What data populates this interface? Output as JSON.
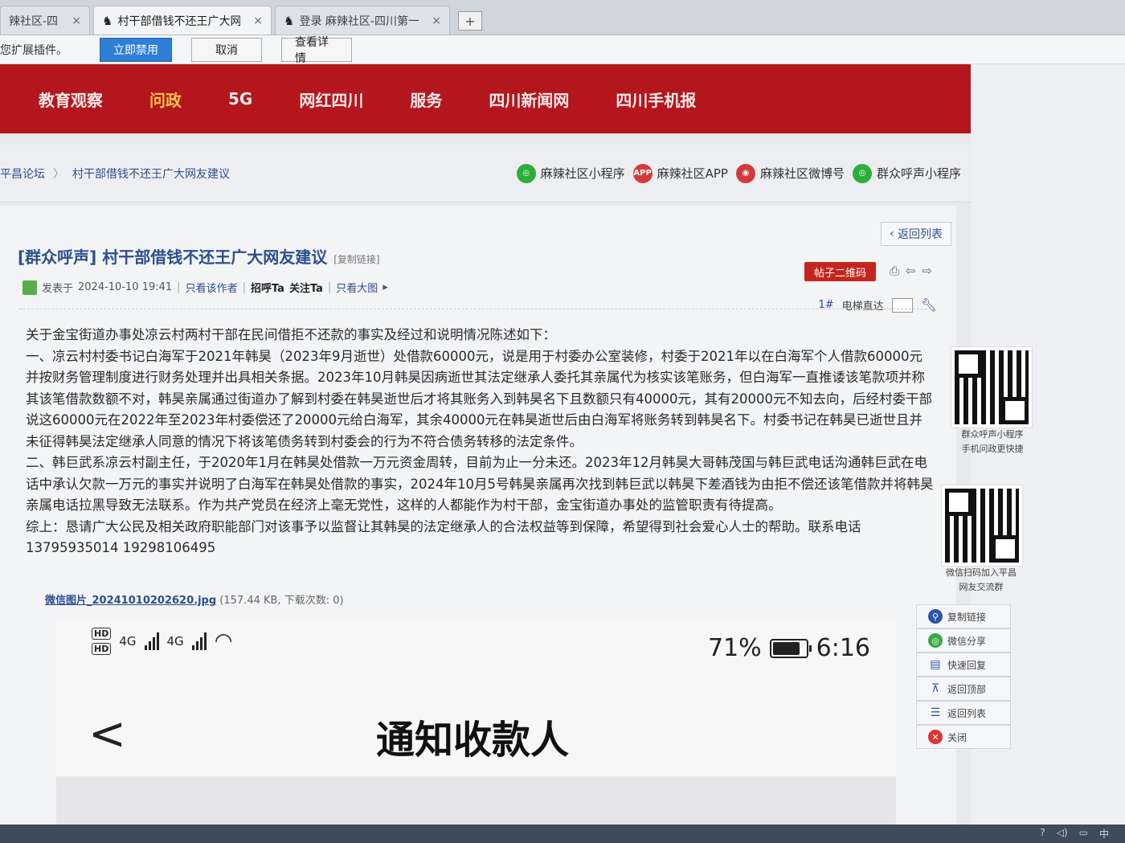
{
  "tabs": [
    {
      "label": "辣社区-四川",
      "close": "×"
    },
    {
      "label": "村干部借钱不还王广大网",
      "close": "×"
    },
    {
      "label": "登录 麻辣社区-四川第一",
      "close": "×"
    }
  ],
  "new_tab_label": "+",
  "notification": {
    "message": "您扩展插件。",
    "disable_label": "立即禁用",
    "cancel_label": "取消",
    "details_label": "查看详情"
  },
  "nav": {
    "items": [
      "教育观察",
      "问政",
      "5G",
      "网红四川",
      "服务",
      "四川新闻网",
      "四川手机报"
    ],
    "highlight_index": 1
  },
  "breadcrumb": {
    "home": "平昌论坛",
    "sep": "〉",
    "current": "村干部借钱不还王广大网友建议"
  },
  "app_links": [
    {
      "icon": "mini-program-icon",
      "label": "麻辣社区小程序"
    },
    {
      "icon": "app-icon",
      "badge": "APP",
      "label": "麻辣社区APP"
    },
    {
      "icon": "weibo-icon",
      "label": "麻辣社区微博号"
    },
    {
      "icon": "mini-program-icon",
      "label": "群众呼声小程序"
    }
  ],
  "back_to_list": "返回列表",
  "post": {
    "title": "[群众呼声] 村干部借钱不还王广大网友建议",
    "copy_link": "[复制链接]",
    "qr_button": "帖子二维码",
    "posted_prefix": "发表于",
    "posted_time": "2024-10-10 19:41",
    "only_author": "只看该作者",
    "greet": "招呼Ta",
    "follow": "关注Ta",
    "big_image": "只看大图",
    "floor_number": "1#",
    "floor_jump": "电梯直达",
    "paragraphs": [
      "关于金宝街道办事处凉云村两村干部在民间借拒不还款的事实及经过和说明情况陈述如下：",
      "一、凉云村村委书记白海军于2021年韩昊（2023年9月逝世）处借款60000元，说是用于村委办公室装修，村委于2021年以在白海军个人借款60000元并按财务管理制度进行财务处理并出具相关条据。2023年10月韩昊因病逝世其法定继承人委托其亲属代为核实该笔账务，但白海军一直推诿该笔款项并称其该笔借款数额不对，韩昊亲属通过街道办了解到村委在韩昊逝世后才将其账务入到韩昊名下且数额只有40000元，其有20000元不知去向，后经村委干部说这60000元在2022年至2023年村委偿还了20000元给白海军，其余40000元在韩昊逝世后由白海军将账务转到韩昊名下。村委书记在韩昊已逝世且并未征得韩昊法定继承人同意的情况下将该笔债务转到村委会的行为不符合债务转移的法定条件。",
      "二、韩巨武系凉云村副主任，于2020年1月在韩昊处借款一万元资金周转，目前为止一分未还。2023年12月韩昊大哥韩茂国与韩巨武电话沟通韩巨武在电话中承认欠款一万元的事实并说明了白海军在韩昊处借款的事实，2024年10月5号韩昊亲属再次找到韩巨武以韩昊下差酒钱为由拒不偿还该笔借款并将韩昊亲属电话拉黑导致无法联系。作为共产党员在经济上毫无党性，这样的人都能作为村干部，金宝街道办事处的监管职责有待提高。",
      "综上：恳请广大公民及相关政府职能部门对该事予以监督让其韩昊的法定继承人的合法权益等到保障，希望得到社会爱心人士的帮助。联系电话 13795935014 19298106495"
    ],
    "attachment": {
      "name": "微信图片_20241010202620.jpg",
      "info": "(157.44 KB, 下载次数: 0)"
    }
  },
  "phone_screenshot": {
    "hd1": "HD",
    "hd2": "HD",
    "net1": "4G",
    "net2": "4G",
    "battery": "71%",
    "time": "6:16",
    "back_glyph": "<",
    "title": "通知收款人"
  },
  "side": {
    "qr1_caption_1": "群众呼声小程序",
    "qr1_caption_2": "手机问政更快捷",
    "qr2_caption_1": "微信扫码加入平昌",
    "qr2_caption_2": "网友交流群",
    "buttons": [
      {
        "icon": "link-icon",
        "label": "复制链接"
      },
      {
        "icon": "wechat-icon",
        "label": "微信分享"
      },
      {
        "icon": "reply-icon",
        "label": "快速回复"
      },
      {
        "icon": "top-icon",
        "label": "返回顶部"
      },
      {
        "icon": "list-icon",
        "label": "返回列表"
      },
      {
        "icon": "close-icon",
        "label": "关闭"
      }
    ]
  }
}
